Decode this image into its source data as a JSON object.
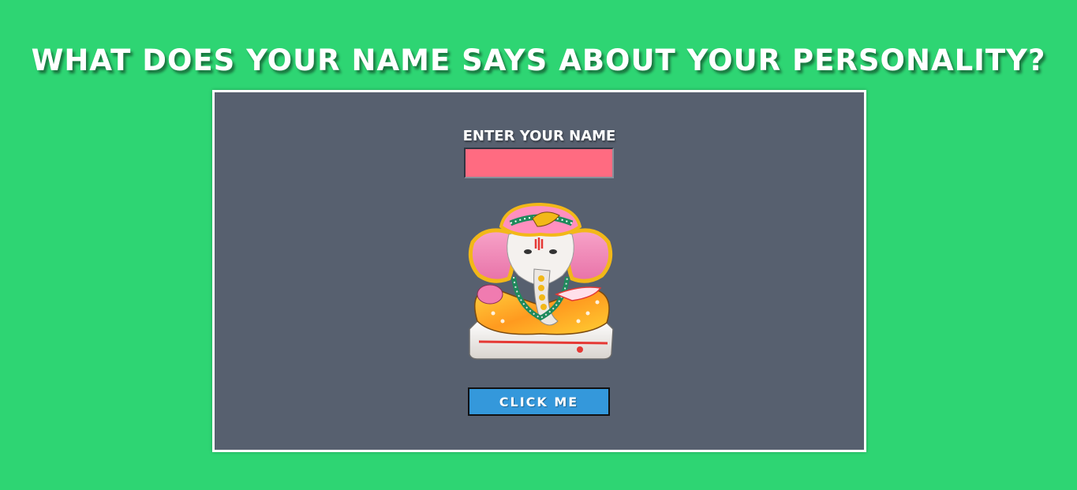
{
  "page": {
    "title": "WHAT DOES YOUR NAME SAYS ABOUT YOUR PERSONALITY?"
  },
  "form": {
    "label": "ENTER YOUR NAME",
    "name_value": "",
    "button_label": "CLICK ME"
  },
  "image": {
    "subject": "ganesha-idol"
  },
  "colors": {
    "background": "#2ed573",
    "card": "#57606f",
    "input": "#ff6b81",
    "button": "#3498db"
  }
}
